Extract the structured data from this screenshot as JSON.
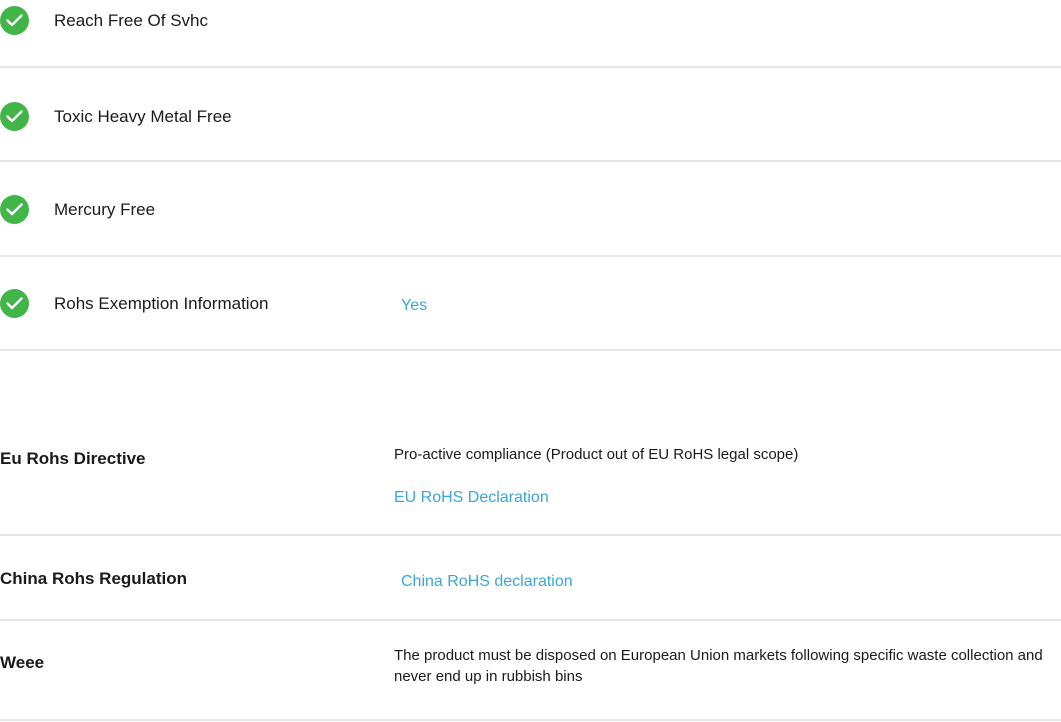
{
  "colors": {
    "check_green": "#42b549",
    "link_blue": "#3aa6d9",
    "divider": "#e6e6e6"
  },
  "checklist": {
    "icon": "check-circle-icon",
    "items": [
      {
        "label": "Reach Free Of Svhc",
        "value": ""
      },
      {
        "label": "Toxic Heavy Metal Free",
        "value": ""
      },
      {
        "label": "Mercury Free",
        "value": ""
      },
      {
        "label": "Rohs Exemption Information",
        "value": "Yes"
      }
    ]
  },
  "regulations": {
    "eu_rohs": {
      "label": "Eu Rohs Directive",
      "text": "Pro-active compliance (Product out of EU RoHS legal scope)",
      "link": "EU RoHS Declaration"
    },
    "china_rohs": {
      "label": "China Rohs Regulation",
      "link": "China RoHS declaration"
    },
    "weee": {
      "label": "Weee",
      "text": "The product must be disposed on European Union markets following specific waste collection and never end up in rubbish bins"
    }
  }
}
